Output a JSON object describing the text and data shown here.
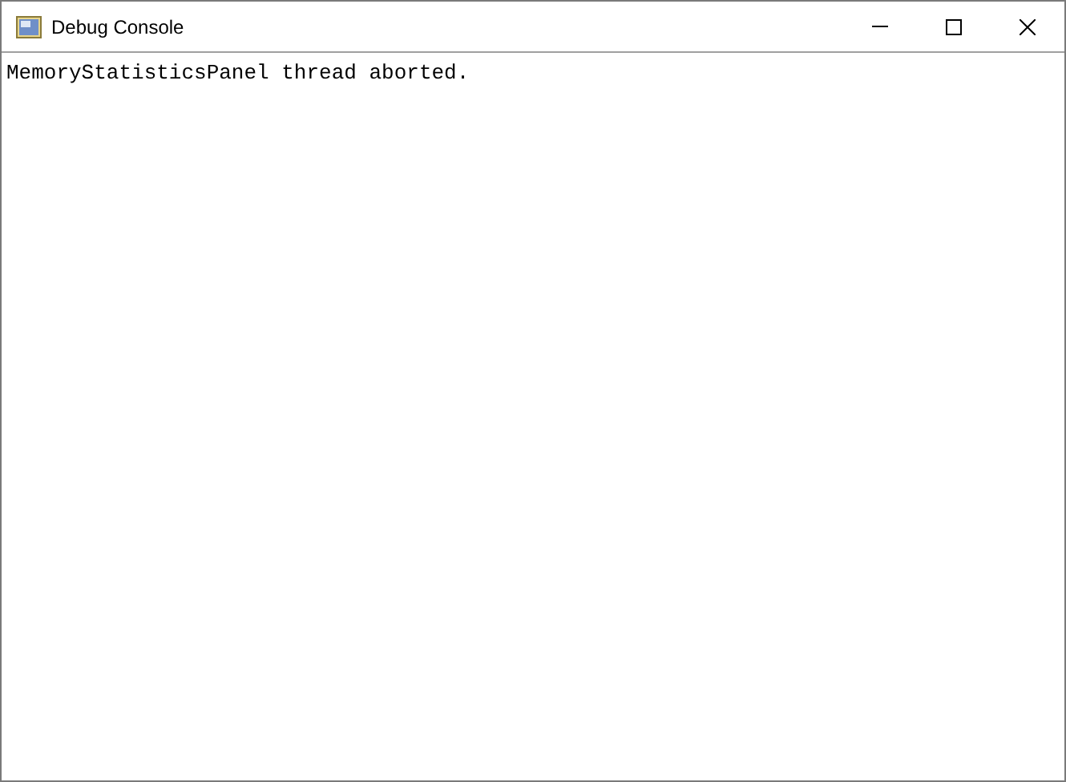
{
  "window": {
    "title": "Debug Console"
  },
  "console": {
    "lines": [
      "MemoryStatisticsPanel thread aborted."
    ]
  }
}
